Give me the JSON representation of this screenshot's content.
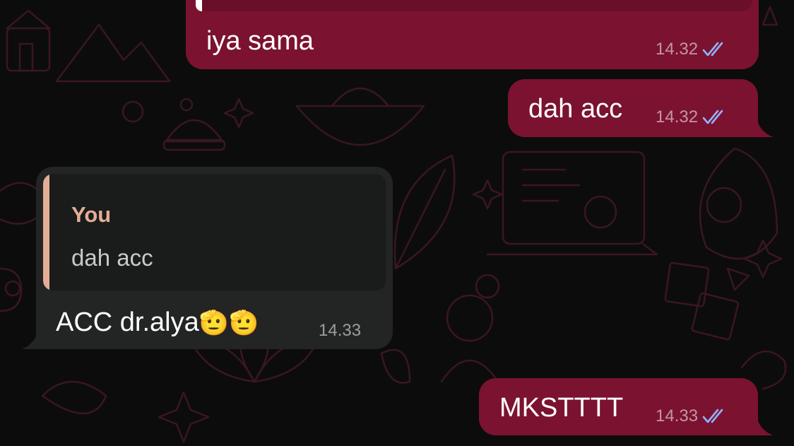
{
  "colors": {
    "outgoing_bubble": "#7b1230",
    "incoming_bubble": "#232424",
    "quote_accent": "#e3ae95",
    "read_ticks": "#8fb4ff",
    "wallpaper_bg": "#0c0c0c"
  },
  "messages": [
    {
      "direction": "outgoing",
      "text": "iya sama",
      "time": "14.32",
      "status_icon": "double-check-read-icon"
    },
    {
      "direction": "outgoing",
      "text": "dah acc",
      "time": "14.32",
      "status_icon": "double-check-read-icon"
    },
    {
      "direction": "incoming",
      "reply": {
        "author": "You",
        "text": "dah acc"
      },
      "text": "ACC dr.alya",
      "emoji": "🫡🫡",
      "time": "14.33"
    },
    {
      "direction": "outgoing",
      "text": "MKSTTTT",
      "time": "14.33",
      "status_icon": "double-check-read-icon"
    }
  ]
}
